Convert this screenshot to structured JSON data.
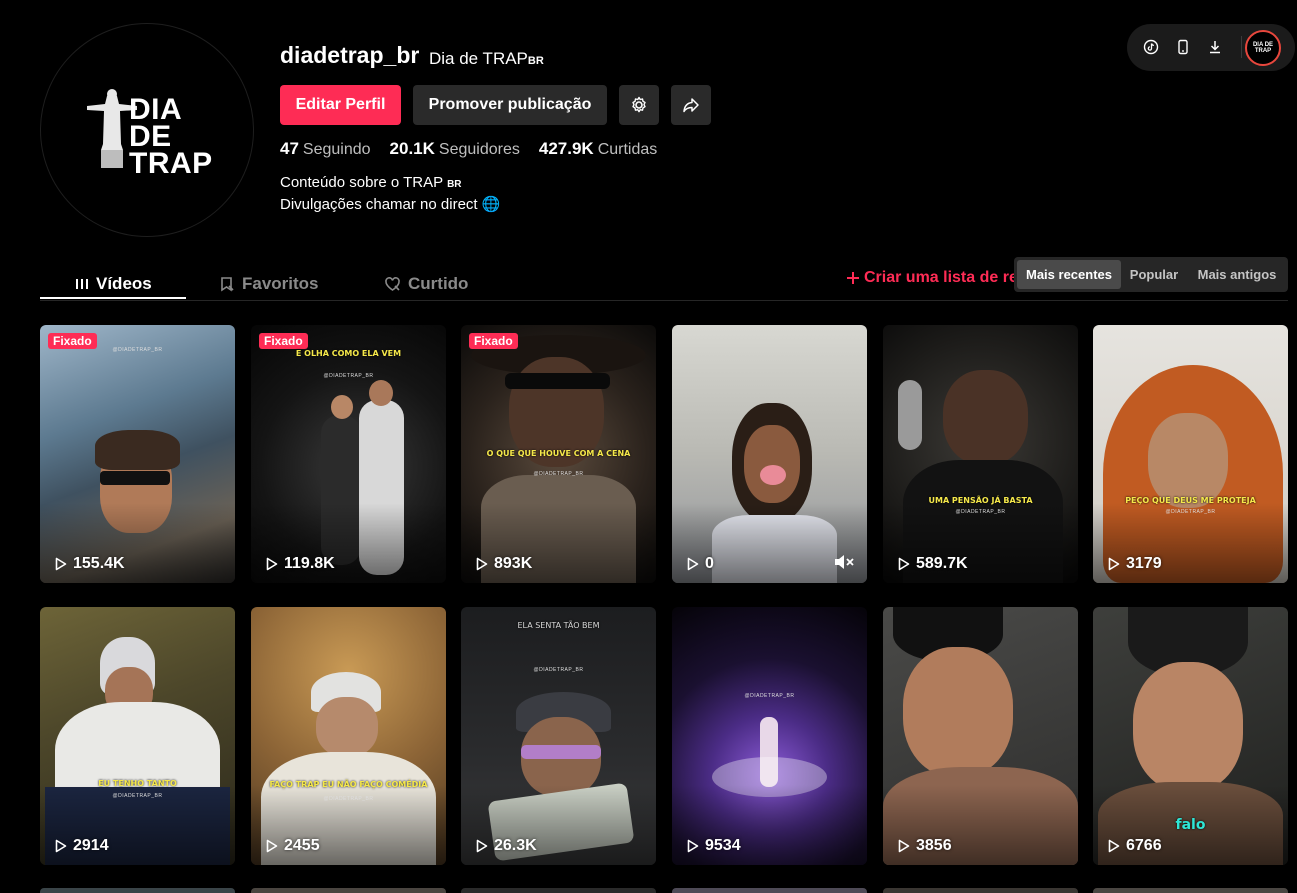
{
  "profile": {
    "username": "diadetrap_br",
    "nickname": "Dia de TRAP",
    "nickname_suffix": "BR",
    "avatar_logo_lines": [
      "DIA",
      "DE",
      "TRAP"
    ],
    "edit_label": "Editar Perfil",
    "promote_label": "Promover publicação",
    "stats": [
      {
        "value": "47",
        "label": "Seguindo"
      },
      {
        "value": "20.1K",
        "label": "Seguidores"
      },
      {
        "value": "427.9K",
        "label": "Curtidas"
      }
    ],
    "bio_line1": "Conteúdo sobre o TRAP",
    "bio_line1_suffix": "BR",
    "bio_line2": "Divulgações chamar no direct 🌐"
  },
  "toolbar": {
    "icons": [
      "tiktok-icon",
      "phone-icon",
      "download-icon"
    ],
    "avatar_text": "DIA DE TRAP"
  },
  "tabs": [
    {
      "label": "Vídeos",
      "icon": "grid-icon",
      "active": true
    },
    {
      "label": "Favoritos",
      "icon": "bookmark-icon",
      "active": false
    },
    {
      "label": "Curtido",
      "icon": "heart-icon",
      "active": false
    }
  ],
  "create_list_label": "Criar uma lista de reprodução",
  "sort_options": [
    {
      "label": "Mais recentes",
      "active": true
    },
    {
      "label": "Popular",
      "active": false
    },
    {
      "label": "Mais antigos",
      "active": false
    }
  ],
  "pinned_label": "Fixado",
  "videos": [
    {
      "views": "155.4K",
      "pinned": true,
      "caption": "",
      "watermark": "@DIADETRAP_BR"
    },
    {
      "views": "119.8K",
      "pinned": true,
      "caption": "E OLHA COMO ELA VEM",
      "watermark": "@DIADETRAP_BR"
    },
    {
      "views": "893K",
      "pinned": true,
      "caption": "O QUE QUE HOUVE COM A CENA",
      "watermark": "@DIADETRAP_BR"
    },
    {
      "views": "0",
      "pinned": false,
      "caption": "",
      "watermark": ""
    },
    {
      "views": "589.7K",
      "pinned": false,
      "caption": "UMA PENSÃO JÁ BASTA",
      "watermark": "@DIADETRAP_BR"
    },
    {
      "views": "3179",
      "pinned": false,
      "caption": "PEÇO QUE DEUS ME PROTEJA",
      "watermark": "@DIADETRAP_BR"
    },
    {
      "views": "2914",
      "pinned": false,
      "caption": "EU TENHO TANTO",
      "watermark": "@DIADETRAP_BR"
    },
    {
      "views": "2455",
      "pinned": false,
      "caption": "FAÇO TRAP EU NÃO FAÇO COMÉDIA",
      "watermark": "@DIADETRAP_BR"
    },
    {
      "views": "26.3K",
      "pinned": false,
      "caption": "ELA SENTA TÃO BEM",
      "watermark": "@DIADETRAP_BR"
    },
    {
      "views": "9534",
      "pinned": false,
      "caption": "",
      "watermark": "@DIADETRAP_BR"
    },
    {
      "views": "3856",
      "pinned": false,
      "caption": "",
      "watermark": ""
    },
    {
      "views": "6766",
      "pinned": false,
      "caption": "falo",
      "watermark": ""
    }
  ],
  "colors": {
    "accent": "#fe2c55",
    "background": "#000000",
    "button_dark": "#2a2a2a"
  }
}
